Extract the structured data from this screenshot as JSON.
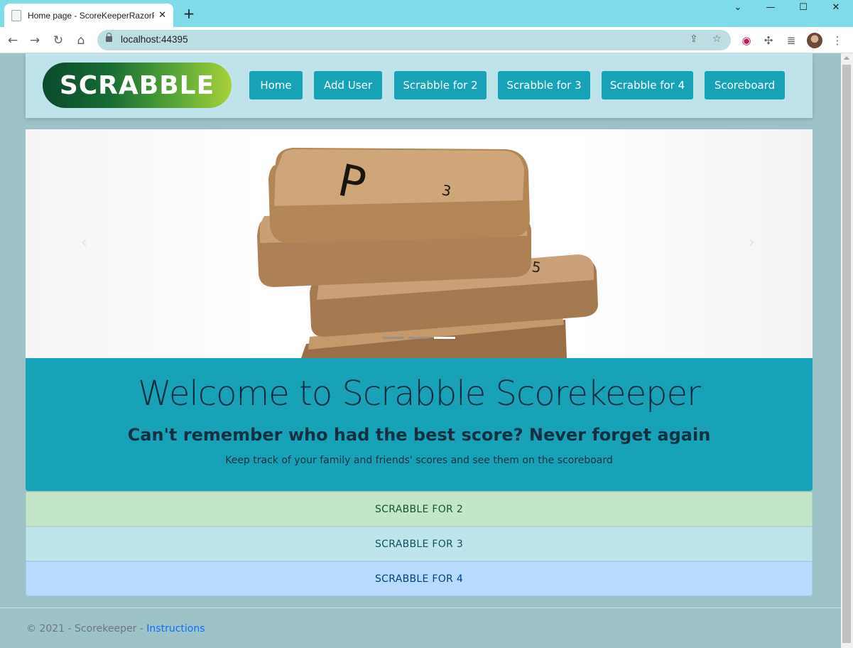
{
  "browser": {
    "tab_title": "Home page - ScoreKeeperRazorP",
    "url": "localhost:44395",
    "close_glyph": "✕",
    "new_tab_glyph": "+"
  },
  "site": {
    "logo_text": "SCRABBLE",
    "nav": [
      "Home",
      "Add User",
      "Scrabble for 2",
      "Scrabble for 3",
      "Scrabble for 4",
      "Scoreboard"
    ]
  },
  "carousel": {
    "slide_count": 3,
    "active_slide": 3,
    "tile_letter": "P",
    "tile_value": "3",
    "prev_glyph": "‹",
    "next_glyph": "›"
  },
  "hero": {
    "title": "Welcome to Scrabble Scorekeeper",
    "subtitle": "Can't remember who had the best score? Never forget again",
    "description": "Keep track of your family and friends' scores and see them on the scoreboard"
  },
  "modes": [
    "SCRABBLE FOR 2",
    "SCRABBLE FOR 3",
    "SCRABBLE FOR 4"
  ],
  "footer": {
    "text": "© 2021 - Scorekeeper - ",
    "link": "Instructions"
  },
  "colors": {
    "accent": "#17a2b8",
    "header_bg": "#bfe3ea",
    "page_bg": "#9dc3c9",
    "mode_2_bg": "#c3e6cb",
    "mode_3_bg": "#bee5eb",
    "mode_4_bg": "#b8daff"
  }
}
